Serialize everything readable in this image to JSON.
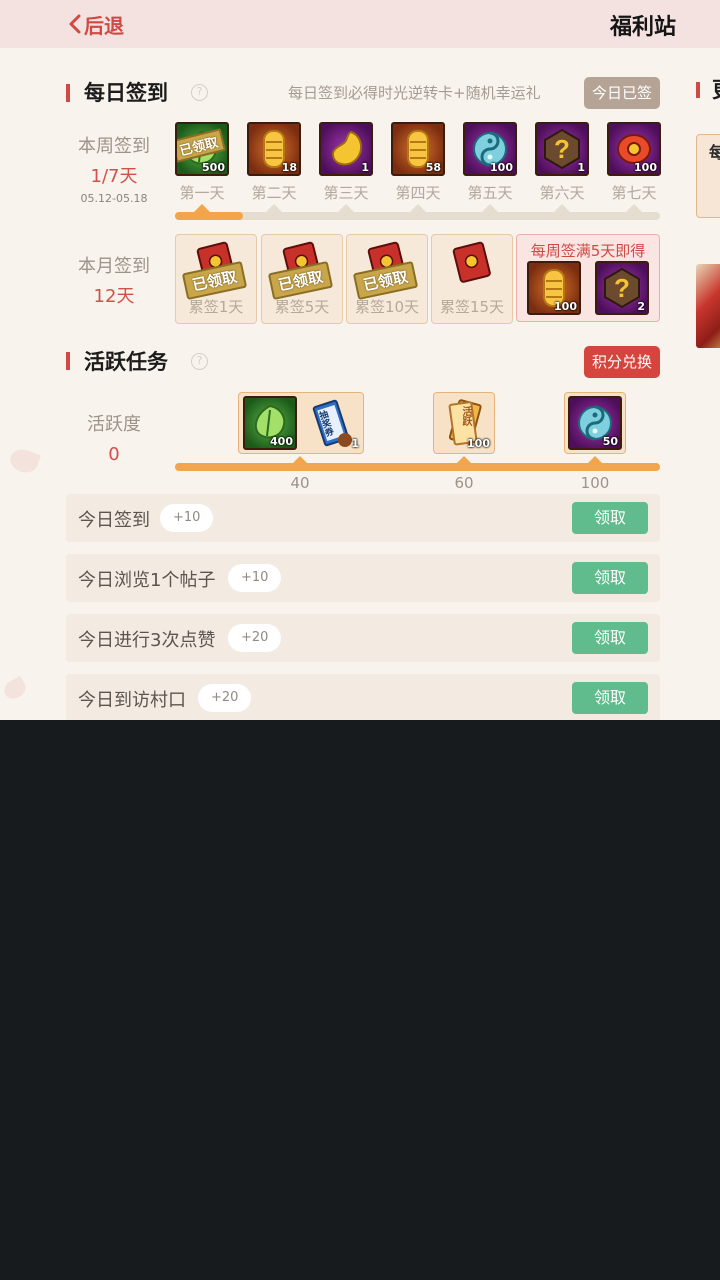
{
  "header": {
    "back_label": "后退",
    "title": "福利站"
  },
  "daily_signin": {
    "title": "每日签到",
    "help": "?",
    "description": "每日签到必得时光逆转卡+随机幸运礼",
    "status_button": "今日已签",
    "week_label": "本周签到",
    "week_progress": "1/7天",
    "date_range": "05.12-05.18",
    "days": [
      {
        "label": "第一天",
        "count": "500",
        "stamp": "已领取",
        "icon": "green-leaf-icon"
      },
      {
        "label": "第二天",
        "count": "18",
        "icon": "gold-scroll-icon"
      },
      {
        "label": "第三天",
        "count": "1",
        "icon": "gold-drop-icon"
      },
      {
        "label": "第四天",
        "count": "58",
        "icon": "gold-scroll-icon"
      },
      {
        "label": "第五天",
        "count": "100",
        "icon": "cyan-orb-icon"
      },
      {
        "label": "第六天",
        "count": "1",
        "icon": "mystery-question-icon"
      },
      {
        "label": "第七天",
        "count": "100",
        "icon": "red-coin-icon"
      }
    ],
    "week_fill": 0.14
  },
  "monthly": {
    "label": "本月签到",
    "value": "12天",
    "cards": [
      {
        "label": "累签1天",
        "stamp": "已领取"
      },
      {
        "label": "累签5天",
        "stamp": "已领取"
      },
      {
        "label": "累签10天",
        "stamp": "已领取"
      },
      {
        "label": "累签15天",
        "stamp": ""
      }
    ],
    "bonus": {
      "title": "每周签满5天即得",
      "items": [
        {
          "count": "100",
          "icon": "gold-scroll-icon"
        },
        {
          "count": "2",
          "icon": "mystery-question-icon"
        }
      ]
    }
  },
  "activity": {
    "title": "活跃任务",
    "help": "?",
    "exchange_button": "积分兑换",
    "label": "活跃度",
    "value": "0",
    "rewards": [
      {
        "milestone": "40",
        "items": [
          {
            "count": "400",
            "icon": "green-leaf-icon"
          },
          {
            "count": "1",
            "icon": "lottery-ticket-icon",
            "text": "抽奖券"
          }
        ]
      },
      {
        "milestone": "60",
        "items": [
          {
            "count": "100",
            "icon": "ticket-bundle-icon",
            "text": "活跃"
          }
        ]
      },
      {
        "milestone": "100",
        "items": [
          {
            "count": "50",
            "icon": "cyan-orb-icon"
          }
        ]
      }
    ],
    "progress_fill": 1.0,
    "tasks": [
      {
        "name": "今日签到",
        "points": "+10",
        "button": "领取"
      },
      {
        "name": "今日浏览1个帖子",
        "points": "+10",
        "button": "领取"
      },
      {
        "name": "今日进行3次点赞",
        "points": "+20",
        "button": "领取"
      },
      {
        "name": "今日到访村口",
        "points": "+20",
        "button": "领取"
      }
    ]
  },
  "peek": {
    "title": "更",
    "card_text": "每"
  },
  "colors": {
    "accent_red": "#cf4a45",
    "progress": "#f2a54a",
    "claim_green": "#60bb8d"
  }
}
